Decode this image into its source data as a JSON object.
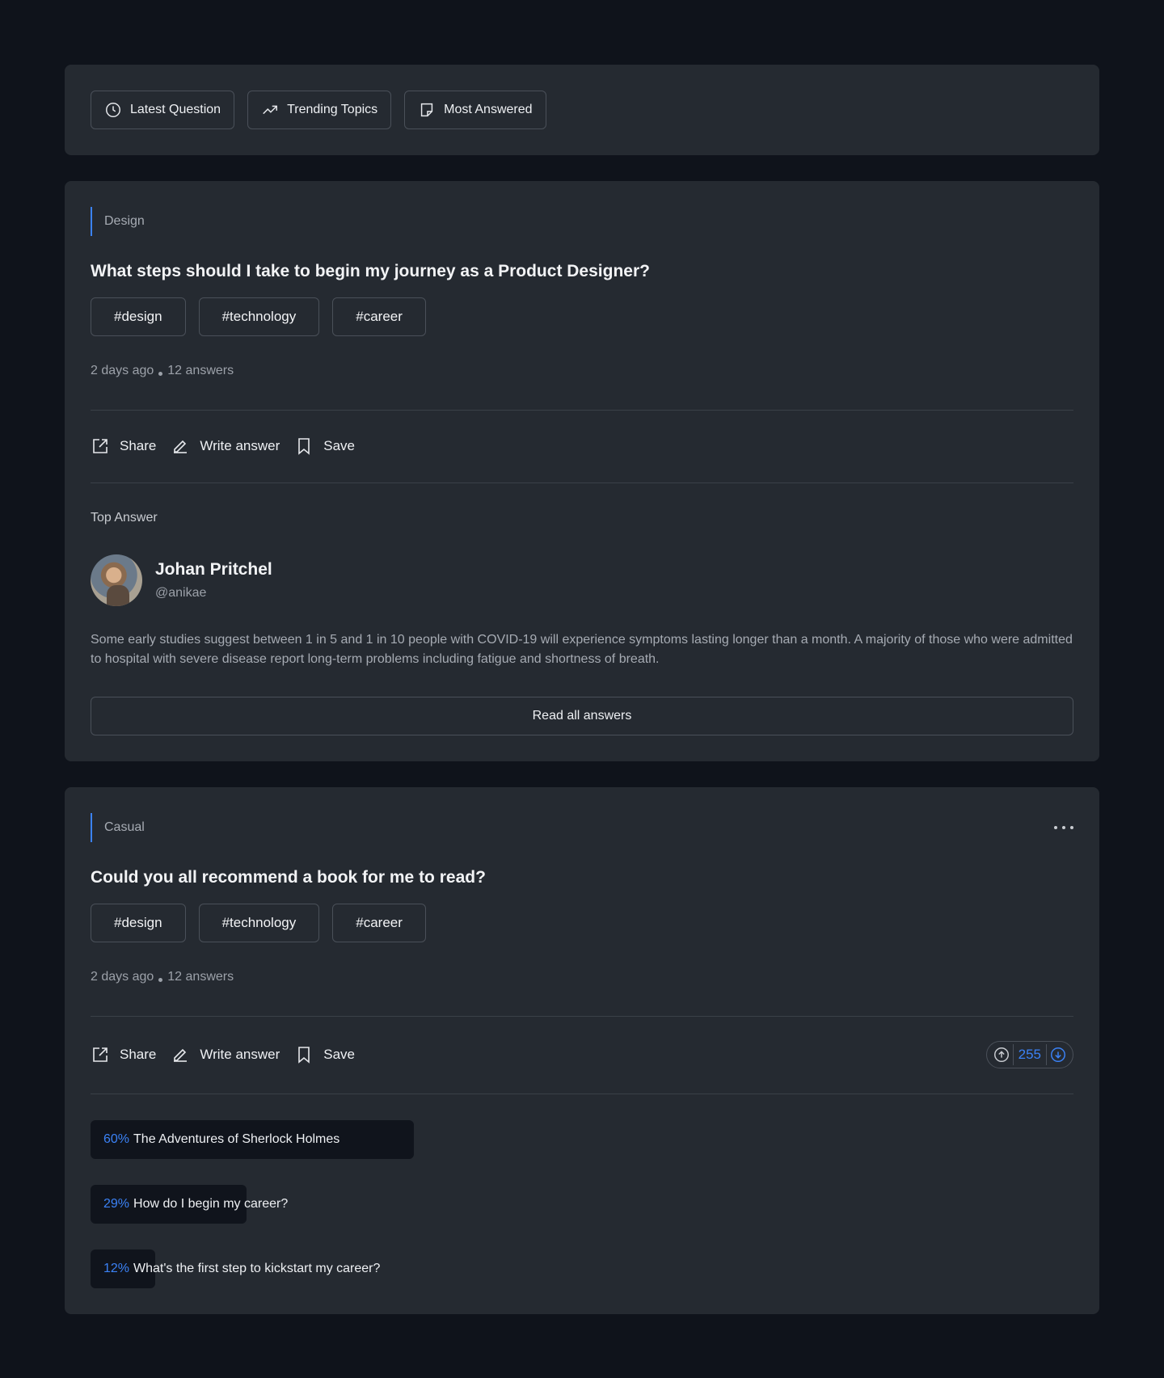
{
  "filters": [
    {
      "label": "Latest Question",
      "icon": "clock-icon"
    },
    {
      "label": "Trending Topics",
      "icon": "trending-up-icon"
    },
    {
      "label": "Most Answered",
      "icon": "note-icon"
    }
  ],
  "question1": {
    "category": "Design",
    "title": "What steps should I take to begin my journey as a Product Designer?",
    "tags": [
      "#design",
      "#technology",
      "#career"
    ],
    "time": "2 days ago",
    "answers": "12 answers",
    "actions": {
      "share": "Share",
      "write": "Write answer",
      "save": "Save"
    },
    "top_answer_label": "Top Answer",
    "author": {
      "name": "Johan Pritchel",
      "handle": "@anikae"
    },
    "answer_text": "Some early studies suggest between 1 in 5 and 1 in 10 people with COVID-19 will experience symptoms lasting longer than a month. A majority of those who were admitted to hospital with severe disease report long-term problems including fatigue and shortness of breath.",
    "read_all": "Read all answers"
  },
  "question2": {
    "category": "Casual",
    "title": "Could you all recommend a book for me to read?",
    "tags": [
      "#design",
      "#technology",
      "#career"
    ],
    "time": "2 days ago",
    "answers": "12 answers",
    "actions": {
      "share": "Share",
      "write": "Write answer",
      "save": "Save"
    },
    "votes": "255",
    "poll": [
      {
        "percent": "60%",
        "value": 60,
        "label": "The Adventures of Sherlock Holmes"
      },
      {
        "percent": "29%",
        "value": 29,
        "label": "How do I begin my career?"
      },
      {
        "percent": "12%",
        "value": 12,
        "label": "What's the first step to kickstart my career?"
      }
    ]
  },
  "colors": {
    "accent": "#3b82f6",
    "card": "#252a31",
    "background": "#0f131b"
  }
}
